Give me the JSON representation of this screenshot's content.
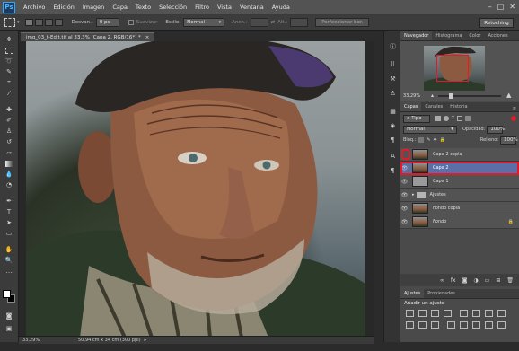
{
  "app": {
    "logo": "Ps"
  },
  "menu": [
    "Archivo",
    "Edición",
    "Imagen",
    "Capa",
    "Texto",
    "Selección",
    "Filtro",
    "Vista",
    "Ventana",
    "Ayuda"
  ],
  "options": {
    "desvan_label": "Desvan.:",
    "desvan_value": "0 px",
    "suavizar_label": "Suavizar",
    "estilo_label": "Estilo:",
    "estilo_value": "Normal",
    "anch_label": "Anch.:",
    "alt_label": "Alt.:",
    "perfeccionar_label": "Perfeccionar bor.",
    "workspace_label": "Retoching"
  },
  "document": {
    "tab_title": "img_03_t-Edit.tif al 33,3% (Capa 2, RGB/16*) *"
  },
  "status": {
    "zoom": "33,29%",
    "doc_size": "50,94 cm x 34 cm (300 ppi)"
  },
  "navigator": {
    "tabs": [
      "Navegador",
      "Histograma",
      "Color",
      "Acciones"
    ],
    "zoom": "33,29%"
  },
  "layers_panel": {
    "tabs": [
      "Capas",
      "Canales",
      "Historia"
    ],
    "filter_label": "Tipo",
    "blend_mode": "Normal",
    "opacity_label": "Opacidad:",
    "opacity_value": "100%",
    "lock_label": "Bloq.:",
    "fill_label": "Relleno:",
    "fill_value": "100%",
    "layers": [
      {
        "name": "Capa 2 copia"
      },
      {
        "name": "Capa 2"
      },
      {
        "name": "Capa 1"
      },
      {
        "name": "Ajustes"
      },
      {
        "name": "Fondo copia"
      },
      {
        "name": "Fondo"
      }
    ],
    "selected_color": "#5a6fa8",
    "highlight_color": "#e11b2b"
  },
  "adjustments_panel": {
    "tabs": [
      "Ajustes",
      "Propiedades"
    ],
    "title": "Añadir un ajuste"
  }
}
